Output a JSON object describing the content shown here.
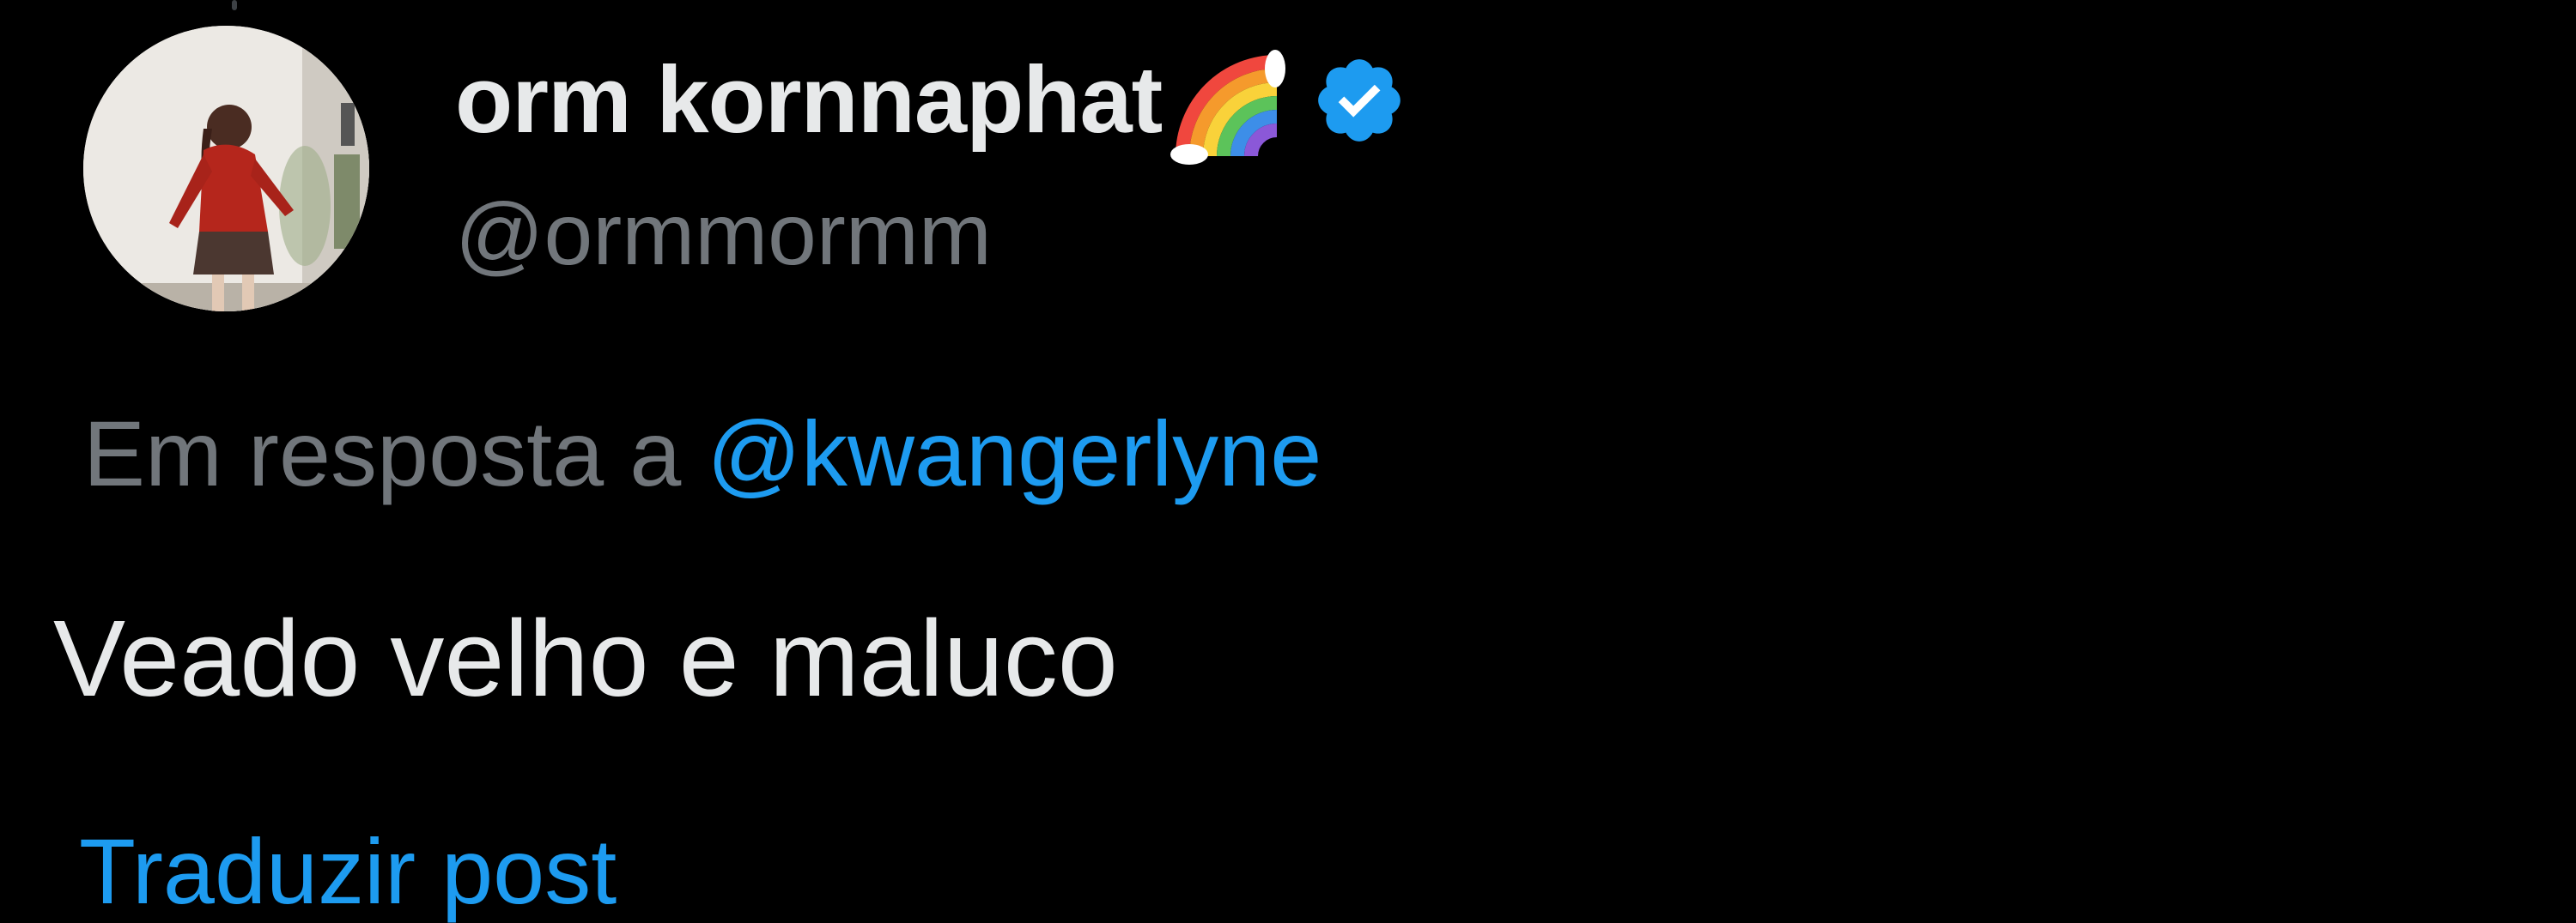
{
  "tweet": {
    "author": {
      "display_name": "orm kornnaphat",
      "name_emoji": "rainbow-emoji",
      "verified": true,
      "verified_icon": "verified-badge-icon",
      "verified_color": "#1d9bf0",
      "handle": "@ormmormm"
    },
    "reply_context": {
      "prefix": "Em resposta a",
      "mention": "@kwangerlyne"
    },
    "text": "Veado velho e maluco",
    "translate_label": "Traduzir post"
  },
  "colors": {
    "background": "#000000",
    "primary_text": "#e7e9ea",
    "secondary_text": "#71767b",
    "link": "#1d9bf0"
  }
}
